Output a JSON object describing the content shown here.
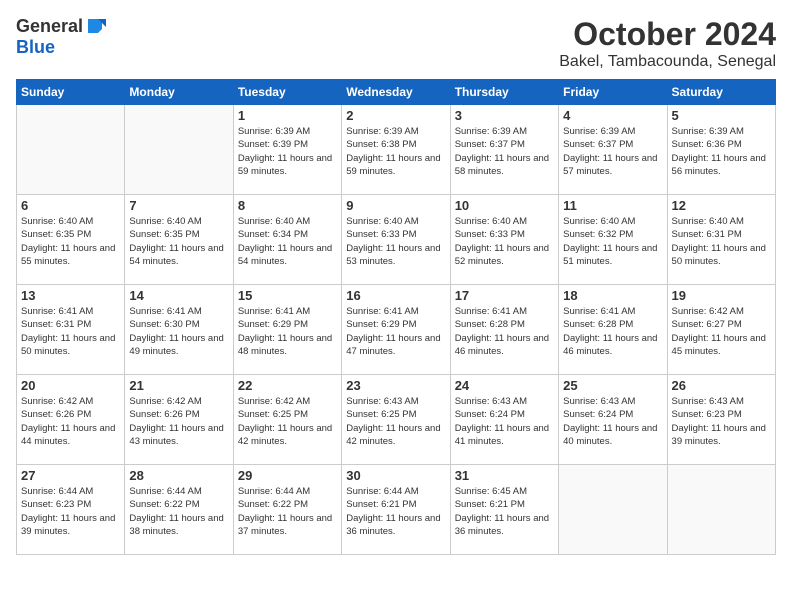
{
  "header": {
    "logo_general": "General",
    "logo_blue": "Blue",
    "month": "October 2024",
    "location": "Bakel, Tambacounda, Senegal"
  },
  "weekdays": [
    "Sunday",
    "Monday",
    "Tuesday",
    "Wednesday",
    "Thursday",
    "Friday",
    "Saturday"
  ],
  "weeks": [
    [
      {
        "day": "",
        "info": ""
      },
      {
        "day": "",
        "info": ""
      },
      {
        "day": "1",
        "info": "Sunrise: 6:39 AM\nSunset: 6:39 PM\nDaylight: 11 hours and 59 minutes."
      },
      {
        "day": "2",
        "info": "Sunrise: 6:39 AM\nSunset: 6:38 PM\nDaylight: 11 hours and 59 minutes."
      },
      {
        "day": "3",
        "info": "Sunrise: 6:39 AM\nSunset: 6:37 PM\nDaylight: 11 hours and 58 minutes."
      },
      {
        "day": "4",
        "info": "Sunrise: 6:39 AM\nSunset: 6:37 PM\nDaylight: 11 hours and 57 minutes."
      },
      {
        "day": "5",
        "info": "Sunrise: 6:39 AM\nSunset: 6:36 PM\nDaylight: 11 hours and 56 minutes."
      }
    ],
    [
      {
        "day": "6",
        "info": "Sunrise: 6:40 AM\nSunset: 6:35 PM\nDaylight: 11 hours and 55 minutes."
      },
      {
        "day": "7",
        "info": "Sunrise: 6:40 AM\nSunset: 6:35 PM\nDaylight: 11 hours and 54 minutes."
      },
      {
        "day": "8",
        "info": "Sunrise: 6:40 AM\nSunset: 6:34 PM\nDaylight: 11 hours and 54 minutes."
      },
      {
        "day": "9",
        "info": "Sunrise: 6:40 AM\nSunset: 6:33 PM\nDaylight: 11 hours and 53 minutes."
      },
      {
        "day": "10",
        "info": "Sunrise: 6:40 AM\nSunset: 6:33 PM\nDaylight: 11 hours and 52 minutes."
      },
      {
        "day": "11",
        "info": "Sunrise: 6:40 AM\nSunset: 6:32 PM\nDaylight: 11 hours and 51 minutes."
      },
      {
        "day": "12",
        "info": "Sunrise: 6:40 AM\nSunset: 6:31 PM\nDaylight: 11 hours and 50 minutes."
      }
    ],
    [
      {
        "day": "13",
        "info": "Sunrise: 6:41 AM\nSunset: 6:31 PM\nDaylight: 11 hours and 50 minutes."
      },
      {
        "day": "14",
        "info": "Sunrise: 6:41 AM\nSunset: 6:30 PM\nDaylight: 11 hours and 49 minutes."
      },
      {
        "day": "15",
        "info": "Sunrise: 6:41 AM\nSunset: 6:29 PM\nDaylight: 11 hours and 48 minutes."
      },
      {
        "day": "16",
        "info": "Sunrise: 6:41 AM\nSunset: 6:29 PM\nDaylight: 11 hours and 47 minutes."
      },
      {
        "day": "17",
        "info": "Sunrise: 6:41 AM\nSunset: 6:28 PM\nDaylight: 11 hours and 46 minutes."
      },
      {
        "day": "18",
        "info": "Sunrise: 6:41 AM\nSunset: 6:28 PM\nDaylight: 11 hours and 46 minutes."
      },
      {
        "day": "19",
        "info": "Sunrise: 6:42 AM\nSunset: 6:27 PM\nDaylight: 11 hours and 45 minutes."
      }
    ],
    [
      {
        "day": "20",
        "info": "Sunrise: 6:42 AM\nSunset: 6:26 PM\nDaylight: 11 hours and 44 minutes."
      },
      {
        "day": "21",
        "info": "Sunrise: 6:42 AM\nSunset: 6:26 PM\nDaylight: 11 hours and 43 minutes."
      },
      {
        "day": "22",
        "info": "Sunrise: 6:42 AM\nSunset: 6:25 PM\nDaylight: 11 hours and 42 minutes."
      },
      {
        "day": "23",
        "info": "Sunrise: 6:43 AM\nSunset: 6:25 PM\nDaylight: 11 hours and 42 minutes."
      },
      {
        "day": "24",
        "info": "Sunrise: 6:43 AM\nSunset: 6:24 PM\nDaylight: 11 hours and 41 minutes."
      },
      {
        "day": "25",
        "info": "Sunrise: 6:43 AM\nSunset: 6:24 PM\nDaylight: 11 hours and 40 minutes."
      },
      {
        "day": "26",
        "info": "Sunrise: 6:43 AM\nSunset: 6:23 PM\nDaylight: 11 hours and 39 minutes."
      }
    ],
    [
      {
        "day": "27",
        "info": "Sunrise: 6:44 AM\nSunset: 6:23 PM\nDaylight: 11 hours and 39 minutes."
      },
      {
        "day": "28",
        "info": "Sunrise: 6:44 AM\nSunset: 6:22 PM\nDaylight: 11 hours and 38 minutes."
      },
      {
        "day": "29",
        "info": "Sunrise: 6:44 AM\nSunset: 6:22 PM\nDaylight: 11 hours and 37 minutes."
      },
      {
        "day": "30",
        "info": "Sunrise: 6:44 AM\nSunset: 6:21 PM\nDaylight: 11 hours and 36 minutes."
      },
      {
        "day": "31",
        "info": "Sunrise: 6:45 AM\nSunset: 6:21 PM\nDaylight: 11 hours and 36 minutes."
      },
      {
        "day": "",
        "info": ""
      },
      {
        "day": "",
        "info": ""
      }
    ]
  ]
}
